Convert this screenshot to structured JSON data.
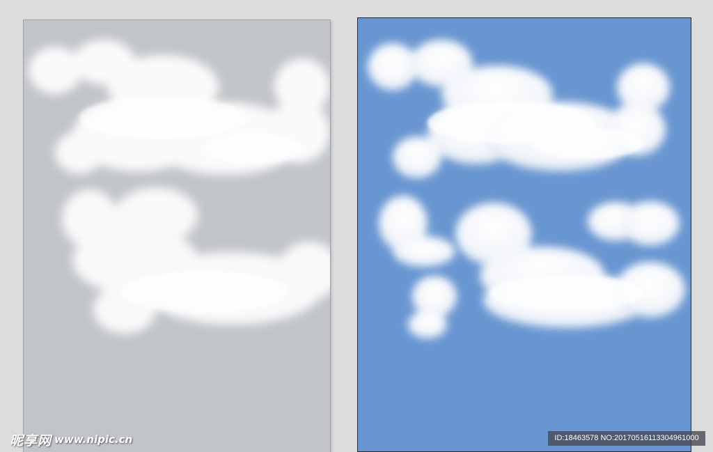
{
  "watermark": {
    "logo_text": "昵享网",
    "url_text": "www.nipic.cn"
  },
  "image_id_banner": {
    "text": "ID:18463578 NO:20170516113304961000"
  },
  "colors": {
    "workspace_background": "#dcdcdc",
    "left_artboard_background": "#c1c4c9",
    "right_artboard_background": "#6896d1",
    "cloud_color": "#ffffff"
  },
  "artboards": [
    {
      "name": "left",
      "background": "gray",
      "content": "clouds"
    },
    {
      "name": "right",
      "background": "blue",
      "content": "clouds"
    }
  ]
}
